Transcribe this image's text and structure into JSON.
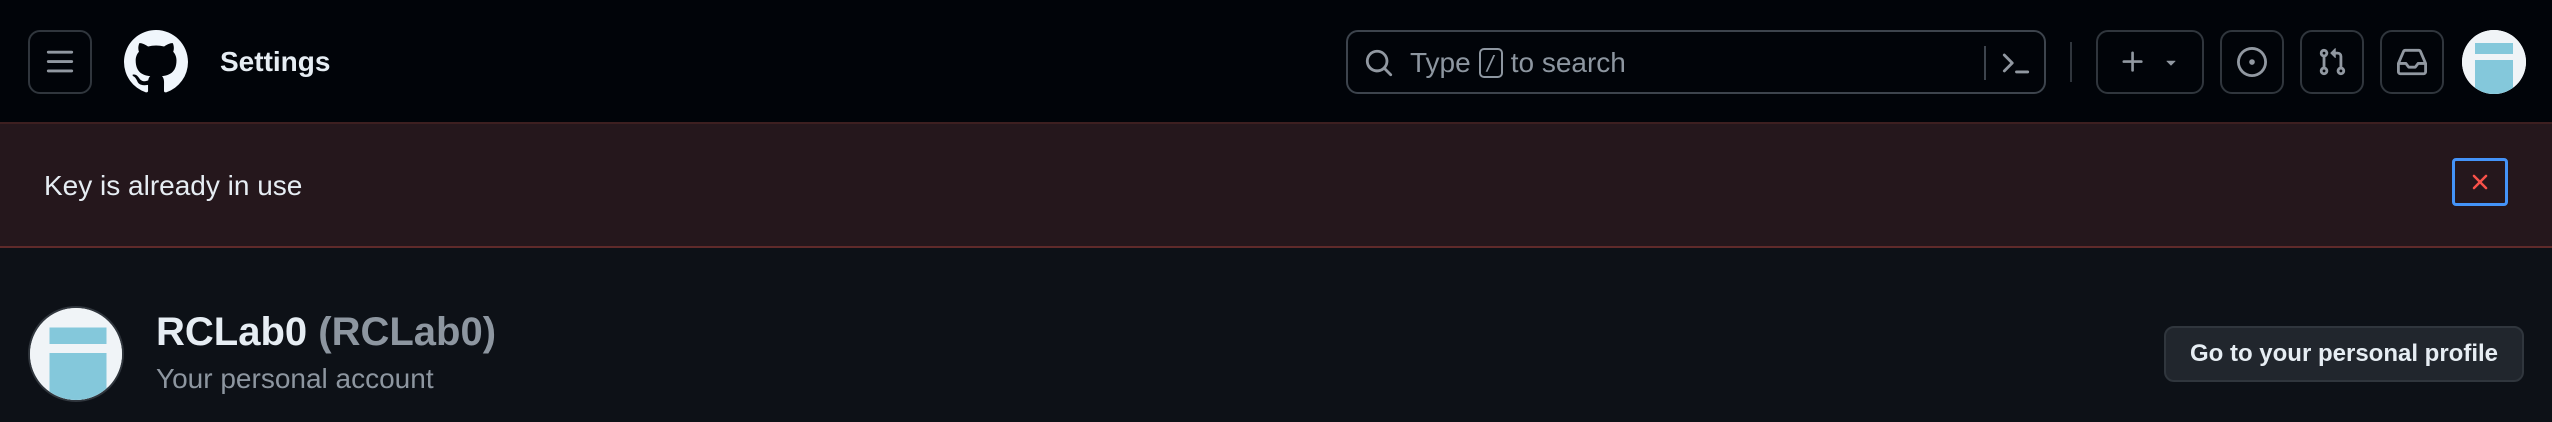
{
  "header": {
    "context_title": "Settings",
    "search": {
      "placeholder_prefix": "Type",
      "placeholder_key": "/",
      "placeholder_suffix": "to search"
    }
  },
  "flash": {
    "message": "Key is already in use",
    "close_icon": "x-icon"
  },
  "account": {
    "display_name": "RCLab0",
    "login": "(RCLab0)",
    "subtitle": "Your personal account",
    "profile_button": "Go to your personal profile"
  },
  "colors": {
    "header_bg": "#010409",
    "page_bg": "#0d1117",
    "flash_bg": "#25171c",
    "flash_border": "#5f2a2a",
    "danger": "#f85149",
    "focus": "#4493f8",
    "avatar_blue": "#84c8db"
  },
  "icons": {
    "menu": "hamburger-icon",
    "logo": "github-mark-icon",
    "search": "search-icon",
    "command": "command-palette-icon",
    "create": "plus-icon",
    "issues": "issue-opened-icon",
    "pulls": "git-pull-request-icon",
    "inbox": "inbox-icon"
  }
}
